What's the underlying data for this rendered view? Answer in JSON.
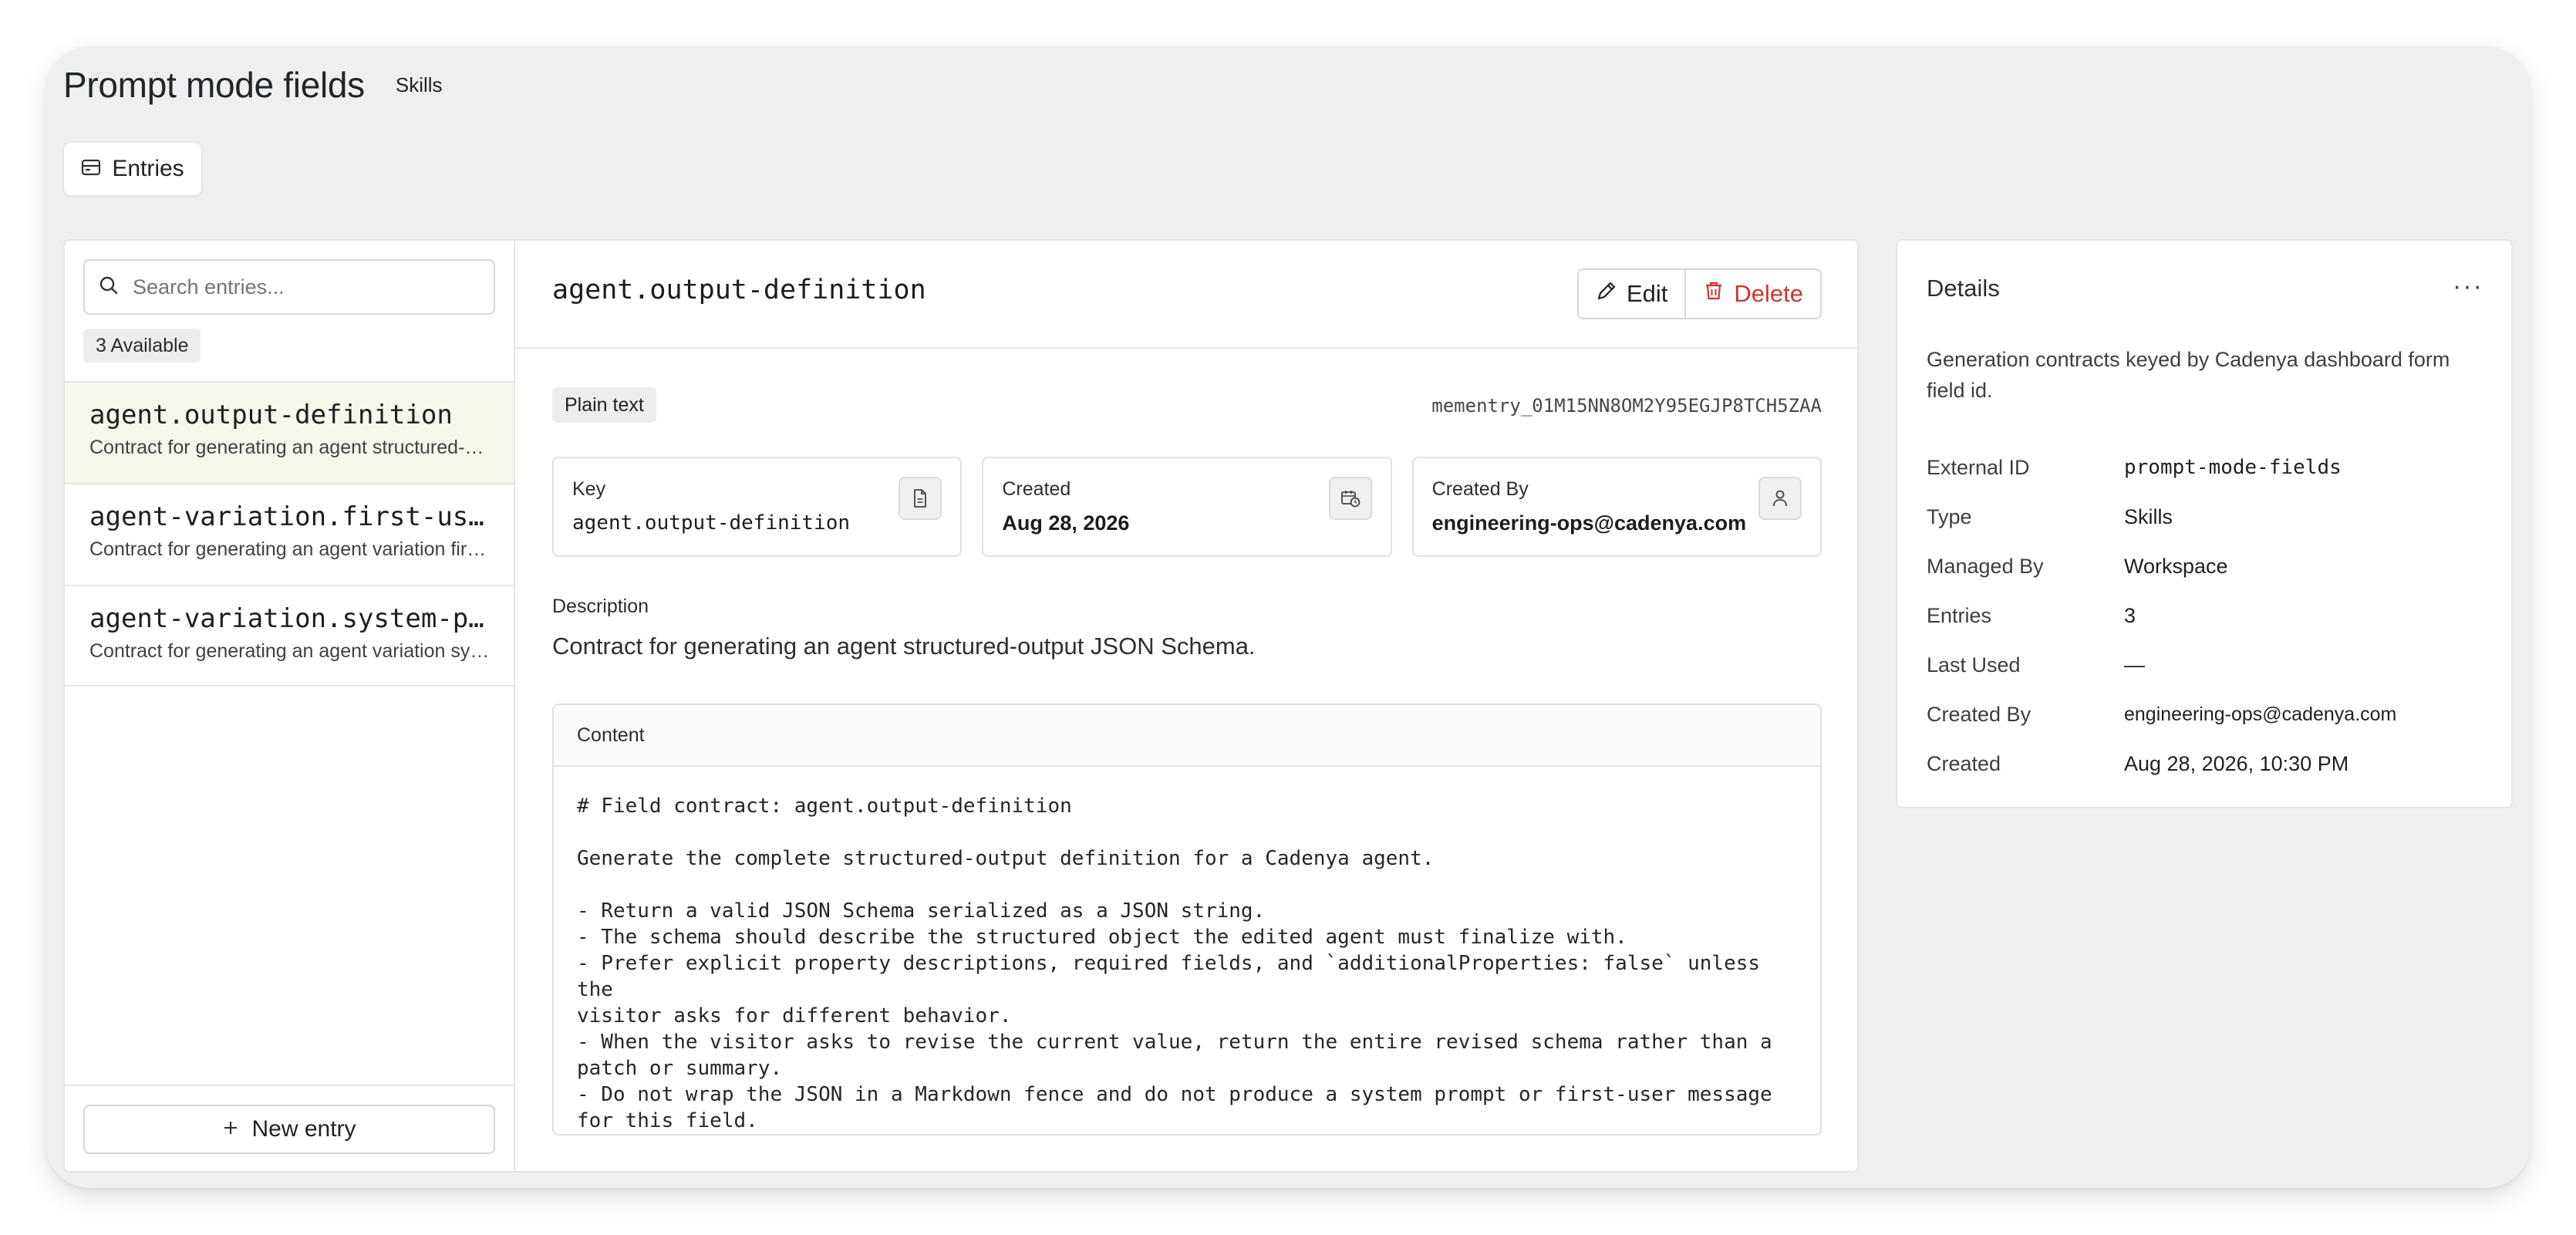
{
  "header": {
    "title": "Prompt mode fields",
    "kind": "Skills"
  },
  "tabs": [
    {
      "label": "Entries",
      "icon": "card-icon"
    }
  ],
  "sidebar": {
    "search_placeholder": "Search entries...",
    "available_badge": "3 Available",
    "items": [
      {
        "key": "agent.output-definition",
        "description": "Contract for generating an agent structured-output JSON Schema.",
        "selected": true
      },
      {
        "key": "agent-variation.first-user-message",
        "description": "Contract for generating an agent variation first-user message.",
        "selected": false
      },
      {
        "key": "agent-variation.system-prompt",
        "description": "Contract for generating an agent variation system prompt.",
        "selected": false
      }
    ],
    "new_entry_label": "New entry"
  },
  "entry": {
    "title": "agent.output-definition",
    "edit_label": "Edit",
    "delete_label": "Delete",
    "format_badge": "Plain text",
    "id": "mementry_01M15NN8OM2Y95EGJP8TCH5ZAA",
    "cards": {
      "key": {
        "label": "Key",
        "value": "agent.output-definition",
        "icon": "document-icon"
      },
      "created": {
        "label": "Created",
        "value": "Aug 28, 2026",
        "icon": "calendar-clock-icon"
      },
      "created_by": {
        "label": "Created By",
        "value": "engineering-ops@cadenya.com",
        "icon": "user-icon"
      }
    },
    "description_label": "Description",
    "description": "Contract for generating an agent structured-output JSON Schema.",
    "content_label": "Content",
    "content": "# Field contract: agent.output-definition\n\nGenerate the complete structured-output definition for a Cadenya agent.\n\n- Return a valid JSON Schema serialized as a JSON string.\n- The schema should describe the structured object the edited agent must finalize with.\n- Prefer explicit property descriptions, required fields, and `additionalProperties: false` unless the\nvisitor asks for different behavior.\n- When the visitor asks to revise the current value, return the entire revised schema rather than a\npatch or summary.\n- Do not wrap the JSON in a Markdown fence and do not produce a system prompt or first-user message\nfor this field."
  },
  "details": {
    "title": "Details",
    "more_label": "···",
    "description": "Generation contracts keyed by Cadenya dashboard form field id.",
    "rows": {
      "external_id": {
        "label": "External ID",
        "value": "prompt-mode-fields"
      },
      "type": {
        "label": "Type",
        "value": "Skills"
      },
      "managed_by": {
        "label": "Managed By",
        "value": "Workspace"
      },
      "entries": {
        "label": "Entries",
        "value": "3"
      },
      "last_used": {
        "label": "Last Used",
        "value": "—"
      },
      "created_by": {
        "label": "Created By",
        "value": "engineering-ops@cadenya.com"
      },
      "created": {
        "label": "Created",
        "value": "Aug 28, 2026, 10:30 PM"
      }
    }
  },
  "colors": {
    "accent_selected_bg": "#f4f8ea",
    "danger": "#d0342c",
    "app_bg": "#eef0f0"
  }
}
